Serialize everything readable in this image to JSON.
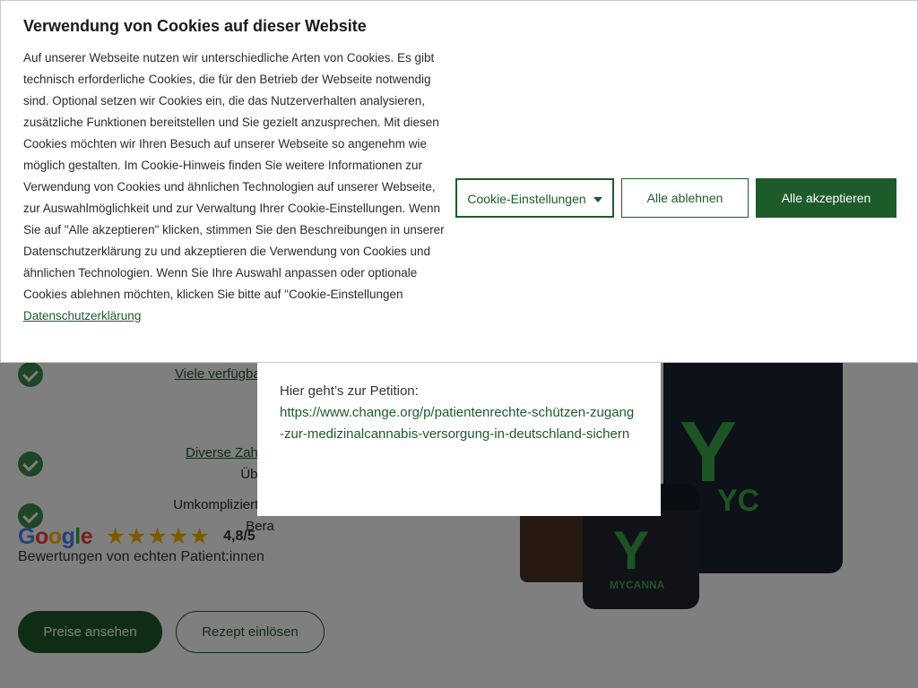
{
  "cookie": {
    "title": "Verwendung von Cookies auf dieser Website",
    "text": "Auf unserer Webseite nutzen wir unterschiedliche Arten von Cookies. Es gibt technisch erforderliche Cookies, die für den Betrieb der Webseite notwendig sind. Optional setzen wir Cookies ein, die das Nutzerverhalten analysieren, zusätzliche Funktionen bereitstellen und Sie gezielt anzusprechen. Mit diesen Cookies möchten wir Ihren Besuch auf unserer Webseite so angenehm wie möglich gestalten. Im Cookie-Hinweis finden Sie weitere Informationen zur Verwendung von Cookies und ähnlichen Technologien auf unserer Webseite, zur Auswahlmöglichkeit und zur Verwaltung Ihrer Cookie-Einstellungen. Wenn Sie auf \"Alle akzeptieren\" klicken, stimmen Sie den Beschreibungen in unserer Datenschutzerklärung zu und akzeptieren die Verwendung von Cookies und ähnlichen Technologien. Wenn Sie Ihre Auswahl anpassen oder optionale Cookies ablehnen möchten, klicken Sie bitte auf \"Cookie-Einstellungen",
    "privacy_link": "Datenschutzerklärung",
    "settings_label": "Cookie-Einstellungen",
    "reject_label": "Alle ablehnen",
    "accept_label": "Alle akzeptieren"
  },
  "modal": {
    "label": "Hier geht’s zur Petition:",
    "link": "https://www.change.org/p/patientenrechte-schützen-zugang-zur-medizinalcannabis-versorgung-in-deutschland-sichern"
  },
  "features": [
    {
      "text": "Viele verfügbare Produkte - j"
    },
    {
      "text": "Diverse Zahlungsoptione",
      "text2": "Überw"
    },
    {
      "text": "Umkomplizierte Rezept-Einlö",
      "text2": "Bera"
    }
  ],
  "rating": {
    "google_letters": [
      "G",
      "o",
      "o",
      "g",
      "l",
      "e"
    ],
    "stars": "★★★★★",
    "score": "4,8/5",
    "rating_value": 4.8,
    "subtitle": "Bewertungen von echten Patient:innen"
  },
  "buttons": {
    "prices_label": "Preise ansehen",
    "recipe_label": "Rezept einlösen"
  },
  "product": {
    "bag_mark": "Y",
    "bag_text": "YC",
    "jar_mark": "Y",
    "jar_brand": "MYCANNA"
  },
  "colors": {
    "brand_green": "#1e5b2b",
    "check_green": "#3d8a4a",
    "star": "#f7b500"
  }
}
